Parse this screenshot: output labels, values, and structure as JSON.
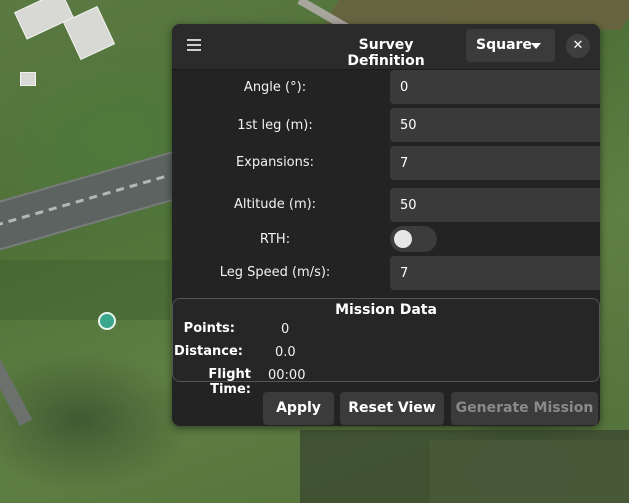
{
  "panel": {
    "title": "Survey Definition",
    "pattern": "Square",
    "close_symbol": "✕"
  },
  "fields": {
    "angle": {
      "label": "Angle (°):",
      "value": "0"
    },
    "first_leg": {
      "label": "1st leg (m):",
      "value": "50"
    },
    "expansions": {
      "label": "Expansions:",
      "value": "7"
    },
    "altitude": {
      "label": "Altitude (m):",
      "value": "50"
    },
    "rth": {
      "label": "RTH:",
      "enabled": false
    },
    "leg_speed": {
      "label": "Leg Speed (m/s):",
      "value": "7"
    }
  },
  "mission_data": {
    "title": "Mission Data",
    "points": {
      "label": "Points:",
      "value": "0"
    },
    "distance": {
      "label": "Distance:",
      "value": "0.0"
    },
    "flight_time": {
      "label": "Flight Time:",
      "value": "00:00"
    }
  },
  "buttons": {
    "apply": "Apply",
    "reset_view": "Reset View",
    "generate_mission": "Generate Mission"
  },
  "colors": {
    "panel_bg": "#232323",
    "input_bg": "#3a3a3a",
    "marker": "#3aa68c"
  },
  "icons": [
    "hamburger-menu-icon",
    "caret-down-icon",
    "close-icon"
  ]
}
